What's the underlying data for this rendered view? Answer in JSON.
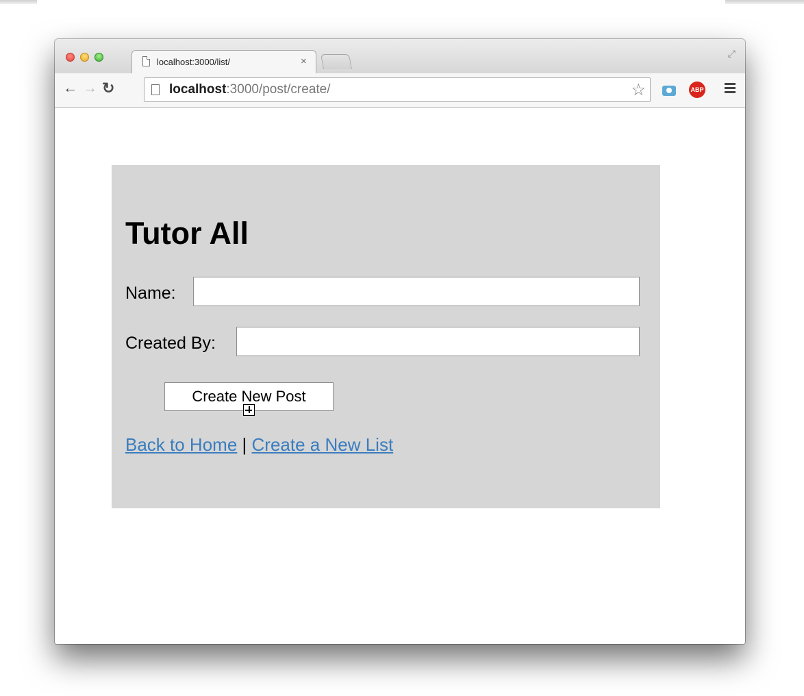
{
  "browser": {
    "tab_title": "localhost:3000/list/",
    "tab_close": "×",
    "url_host": "localhost",
    "url_port": ":3000",
    "url_path": "/post/create/",
    "extension_abp_label": "ABP"
  },
  "page": {
    "heading": "Tutor All",
    "name_label": "Name:",
    "name_value": "",
    "created_by_label": "Created By:",
    "created_by_value": "",
    "submit_label": "Create New Post",
    "link_home": "Back to Home",
    "link_separator": "|",
    "link_new_list": "Create a New List"
  },
  "colors": {
    "panel_background": "#d6d6d6",
    "link": "#3a7dbf"
  }
}
